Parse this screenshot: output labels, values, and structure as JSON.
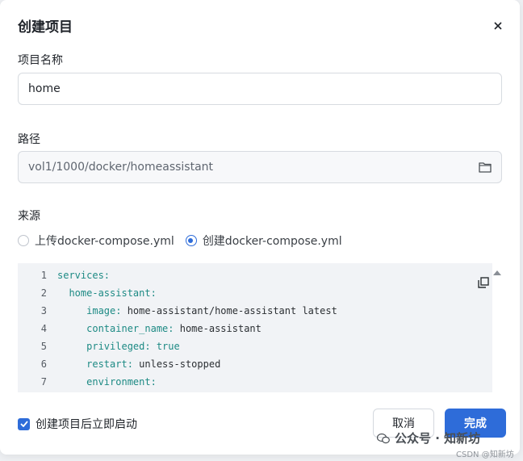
{
  "dialog": {
    "title": "创建项目",
    "close_icon": "close-icon"
  },
  "project_name": {
    "label": "项目名称",
    "value": "home"
  },
  "path": {
    "label": "路径",
    "value": "vol1/1000/docker/homeassistant",
    "icon": "folder-icon"
  },
  "source": {
    "label": "来源",
    "options": [
      {
        "label": "上传docker-compose.yml",
        "selected": false
      },
      {
        "label": "创建docker-compose.yml",
        "selected": true
      }
    ]
  },
  "editor": {
    "lines": [
      {
        "num": "1",
        "key": "services",
        "sep": ":",
        "value": "",
        "indent": ""
      },
      {
        "num": "2",
        "key": "home-assistant",
        "sep": ":",
        "value": "",
        "indent": "  "
      },
      {
        "num": "3",
        "key": "image",
        "sep": ": ",
        "value": "home-assistant/home-assistant latest",
        "indent": "     "
      },
      {
        "num": "4",
        "key": "container_name",
        "sep": ": ",
        "value": "home-assistant",
        "indent": "     "
      },
      {
        "num": "5",
        "key": "privileged",
        "sep": ": ",
        "value": "true",
        "indent": "     "
      },
      {
        "num": "6",
        "key": "restart",
        "sep": ": ",
        "value": "unless-stopped",
        "indent": "     "
      },
      {
        "num": "7",
        "key": "environment",
        "sep": ":",
        "value": "",
        "indent": "     "
      }
    ],
    "copy_icon": "copy-icon"
  },
  "start_after_create": {
    "label": "创建项目后立即启动",
    "checked": true
  },
  "buttons": {
    "cancel": "取消",
    "confirm": "完成"
  },
  "watermark": {
    "text": "公众号 · 知新坊",
    "csdn": "CSDN @知新坊"
  },
  "colors": {
    "accent": "#2e6cd9",
    "code_bg": "#f1f3f6",
    "key": "#1d8a84"
  }
}
